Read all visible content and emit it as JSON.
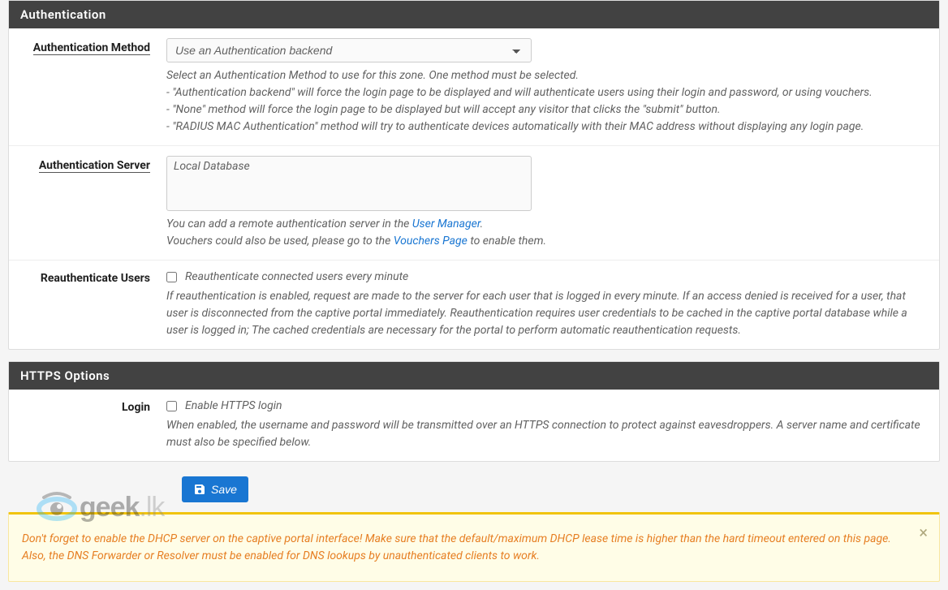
{
  "auth": {
    "header": "Authentication",
    "method": {
      "label": "Authentication Method",
      "selected": "Use an Authentication backend",
      "help_intro": "Select an Authentication Method to use for this zone. One method must be selected.",
      "help_1": "- \"Authentication backend\" will force the login page to be displayed and will authenticate users using their login and password, or using vouchers.",
      "help_2": "- \"None\" method will force the login page to be displayed but will accept any visitor that clicks the \"submit\" button.",
      "help_3": "- \"RADIUS MAC Authentication\" method will try to authenticate devices automatically with their MAC address without displaying any login page."
    },
    "server": {
      "label": "Authentication Server",
      "selected": "Local Database",
      "help_pre": "You can add a remote authentication server in the ",
      "help_link": "User Manager",
      "help_post": ".",
      "help2_pre": "Vouchers could also be used, please go to the ",
      "help2_link": "Vouchers Page",
      "help2_post": " to enable them."
    },
    "reauth": {
      "label": "Reauthenticate Users",
      "checkbox_label": "Reauthenticate connected users every minute",
      "help": "If reauthentication is enabled, request are made to the server for each user that is logged in every minute. If an access denied is received for a user, that user is disconnected from the captive portal immediately. Reauthentication requires user credentials to be cached in the captive portal database while a user is logged in; The cached credentials are necessary for the portal to perform automatic reauthentication requests."
    }
  },
  "https": {
    "header": "HTTPS Options",
    "login": {
      "label": "Login",
      "checkbox_label": "Enable HTTPS login",
      "help": "When enabled, the username and password will be transmitted over an HTTPS connection to protect against eavesdroppers. A server name and certificate must also be specified below."
    }
  },
  "save_label": "Save",
  "alert_text": "Don't forget to enable the DHCP server on the captive portal interface! Make sure that the default/maximum DHCP lease time is higher than the hard timeout entered on this page. Also, the DNS Forwarder or Resolver must be enabled for DNS lookups by unauthenticated clients to work.",
  "watermark": {
    "brand": "geek",
    "suffix": ".lk"
  }
}
